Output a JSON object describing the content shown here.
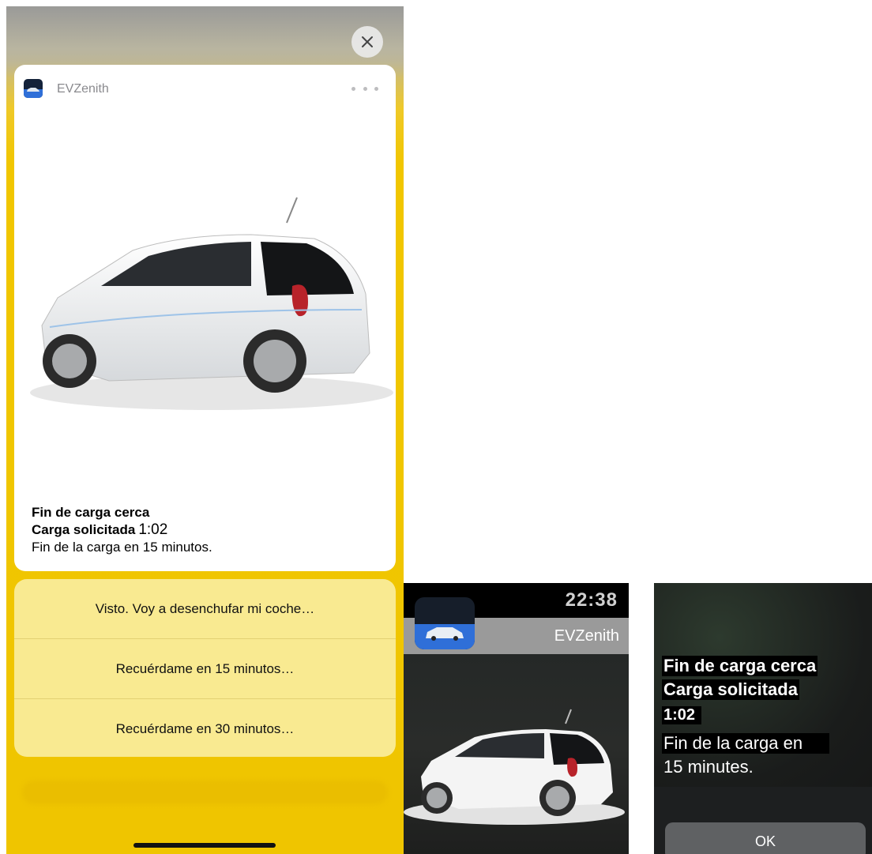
{
  "phone": {
    "app_name": "EVZenith",
    "notification": {
      "title": "Fin de carga cerca",
      "subtitle": "Carga solicitada",
      "time": "1:02",
      "body": "Fin de la carga en 15 minutos."
    },
    "actions": [
      {
        "label": "Visto. Voy a desenchufar mi coche…"
      },
      {
        "label": "Recuérdame en 15 minutos…"
      },
      {
        "label": "Recuérdame en 30 minutos…"
      }
    ]
  },
  "watch_notification": {
    "time": "22:38",
    "app_name": "EVZenith"
  },
  "watch_detail": {
    "title": "Fin de carga cerca",
    "subtitle": "Carga solicitada",
    "time": "1:02",
    "body_line1": "Fin de la carga en",
    "body_line2": "15 minutes.",
    "ok_label": "OK"
  },
  "icons": [
    "close-icon",
    "more-icon",
    "app-icon",
    "car-image"
  ]
}
